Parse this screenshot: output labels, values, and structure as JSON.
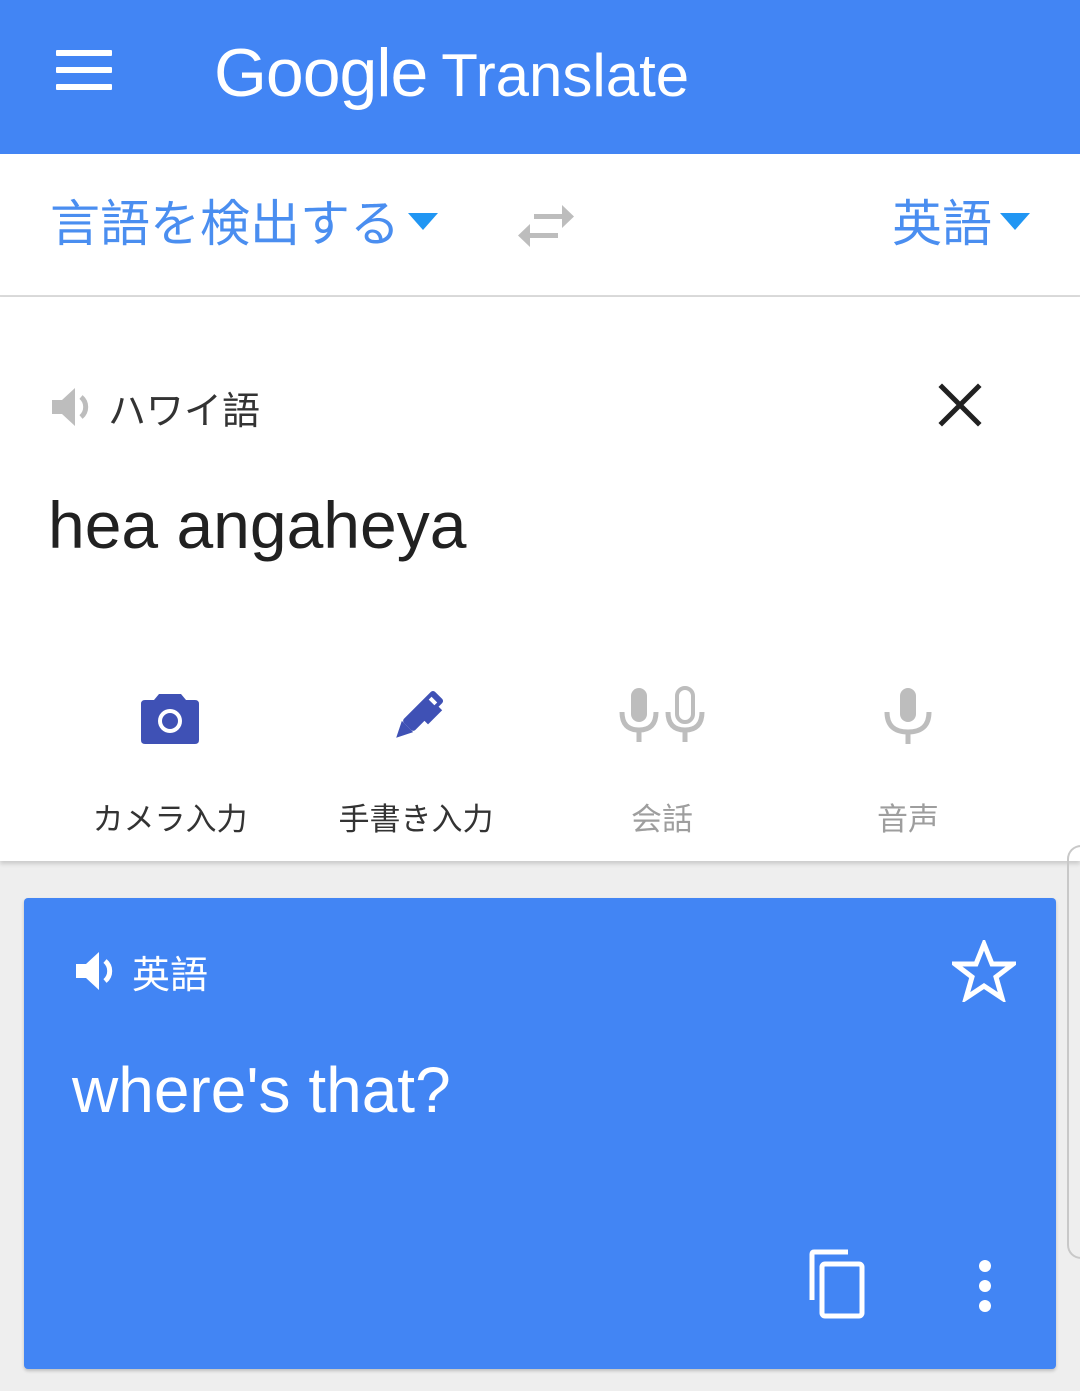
{
  "app_bar": {
    "title_brand": "Google",
    "title_product": "Translate",
    "menu_icon": "hamburger-menu-icon"
  },
  "language_bar": {
    "source_language": "言語を検出する",
    "target_language": "英語",
    "swap_icon": "swap-languages-icon",
    "accent_color": "#2196f3"
  },
  "source": {
    "detected_language": "ハワイ語",
    "input_text": "hea angaheya",
    "speaker_icon": "speaker-icon",
    "clear_icon": "close-icon"
  },
  "input_tools": [
    {
      "label": "カメラ入力",
      "icon": "camera-icon",
      "enabled": true
    },
    {
      "label": "手書き入力",
      "icon": "pen-icon",
      "enabled": true
    },
    {
      "label": "会話",
      "icon": "conversation-mic-icon",
      "enabled": false
    },
    {
      "label": "音声",
      "icon": "mic-icon",
      "enabled": false
    }
  ],
  "result": {
    "language": "英語",
    "translated_text": "where's that?",
    "speaker_icon": "speaker-icon",
    "star_icon": "star-outline-icon",
    "copy_icon": "copy-icon",
    "more_icon": "more-vert-icon",
    "background_color": "#4285f4"
  },
  "colors": {
    "primary": "#4285f4",
    "tool_active": "#3f51b5",
    "tool_disabled": "#bdbdbd"
  }
}
